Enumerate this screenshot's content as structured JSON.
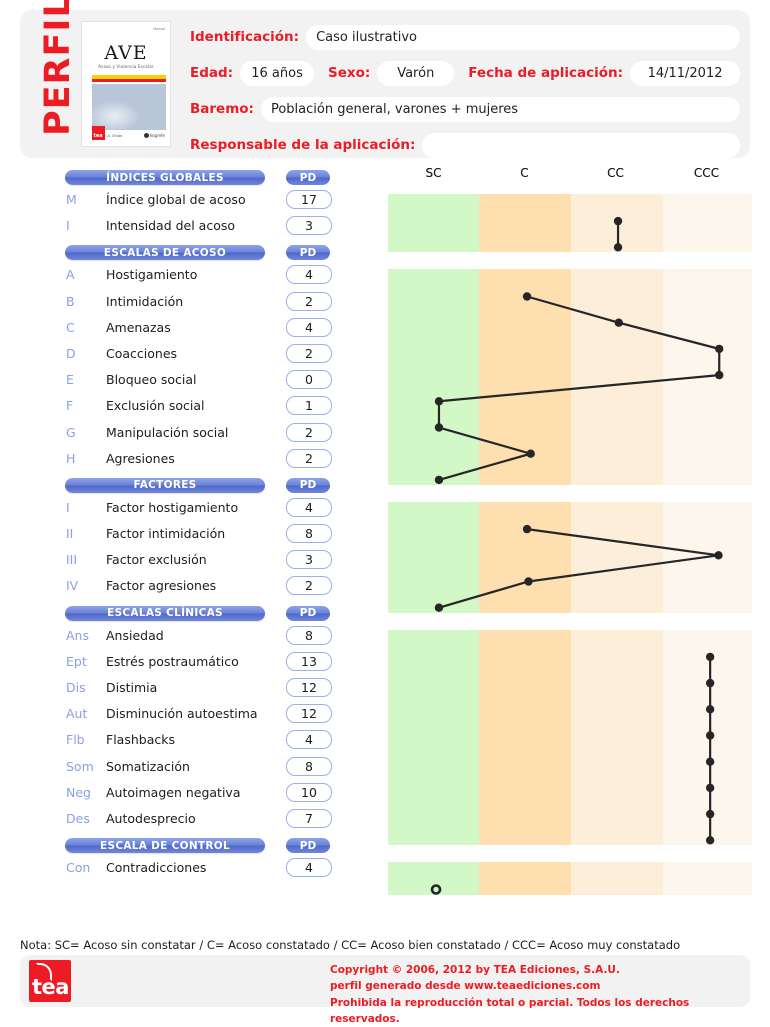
{
  "header": {
    "side_title": "PERFIL",
    "cover": {
      "manual_tag": "Manual",
      "title": "AVE",
      "subtitle": "Acoso y Violencia Escolar",
      "authors": "I. Piñuel\nA. Oñate",
      "brand": "tea",
      "publisher": "hogrefe"
    },
    "fields": [
      {
        "label": "Identificación:",
        "value": "Caso ilustrativo"
      },
      {
        "label": "Edad:",
        "value": "16 años"
      },
      {
        "label": "Sexo:",
        "value": "Varón"
      },
      {
        "label": "Fecha de aplicación:",
        "value": "14/11/2012"
      },
      {
        "label": "Baremo:",
        "value": "Población general, varones + mujeres"
      },
      {
        "label": "Responsable de la aplicación:",
        "value": ""
      }
    ]
  },
  "pd_header": "PD",
  "sections": [
    {
      "title": "ÍNDICES GLOBALES",
      "rows": [
        {
          "code": "M",
          "name": "Índice global de acoso",
          "pd": "17"
        },
        {
          "code": "I",
          "name": "Intensidad del acoso",
          "pd": "3"
        }
      ]
    },
    {
      "title": "ESCALAS DE ACOSO",
      "rows": [
        {
          "code": "A",
          "name": "Hostigamiento",
          "pd": "4"
        },
        {
          "code": "B",
          "name": "Intimidación",
          "pd": "2"
        },
        {
          "code": "C",
          "name": "Amenazas",
          "pd": "4"
        },
        {
          "code": "D",
          "name": "Coacciones",
          "pd": "2"
        },
        {
          "code": "E",
          "name": "Bloqueo social",
          "pd": "0"
        },
        {
          "code": "F",
          "name": "Exclusión social",
          "pd": "1"
        },
        {
          "code": "G",
          "name": "Manipulación social",
          "pd": "2"
        },
        {
          "code": "H",
          "name": "Agresiones",
          "pd": "2"
        }
      ]
    },
    {
      "title": "FACTORES",
      "rows": [
        {
          "code": "I",
          "name": "Factor hostigamiento",
          "pd": "4"
        },
        {
          "code": "II",
          "name": "Factor intimidación",
          "pd": "8"
        },
        {
          "code": "III",
          "name": "Factor exclusión",
          "pd": "3"
        },
        {
          "code": "IV",
          "name": "Factor agresiones",
          "pd": "2"
        }
      ]
    },
    {
      "title": "ESCALAS CLÍNICAS",
      "rows": [
        {
          "code": "Ans",
          "name": "Ansiedad",
          "pd": "8"
        },
        {
          "code": "Ept",
          "name": "Estrés postraumático",
          "pd": "13"
        },
        {
          "code": "Dis",
          "name": "Distimia",
          "pd": "12"
        },
        {
          "code": "Aut",
          "name": "Disminución autoestima",
          "pd": "12"
        },
        {
          "code": "Flb",
          "name": "Flashbacks",
          "pd": "4"
        },
        {
          "code": "Som",
          "name": "Somatización",
          "pd": "8"
        },
        {
          "code": "Neg",
          "name": "Autoimagen negativa",
          "pd": "10"
        },
        {
          "code": "Des",
          "name": "Autodesprecio",
          "pd": "7"
        }
      ]
    },
    {
      "title": "ESCALA DE CONTROL",
      "rows": [
        {
          "code": "Con",
          "name": "Contradicciones",
          "pd": "4"
        }
      ]
    }
  ],
  "chart_data": {
    "type": "line",
    "title": "",
    "xlabel": "",
    "ylabel": "",
    "orientation": "horizontal",
    "grid": false,
    "legend_position": "none",
    "categories": [
      "SC",
      "C",
      "CC",
      "CCC"
    ],
    "band_colors": [
      "#d3f8c8",
      "#fddfb0",
      "#fdeed9",
      "#fdf6ed"
    ],
    "band_labels_top": [
      "SC",
      "C",
      "CC",
      "CCC"
    ],
    "band_labels_bottom": [
      "SC",
      "C",
      "CC",
      "CCC"
    ],
    "marker_color": "#262626",
    "line_color": "#262626",
    "blocks": [
      {
        "name": "ÍNDICES GLOBALES",
        "points": [
          {
            "label": "Índice global de acoso",
            "code": "M",
            "pd": 17,
            "band": "CC",
            "x": 0.632
          },
          {
            "label": "Intensidad del acoso",
            "code": "I",
            "pd": 3,
            "band": "CC",
            "x": 0.632
          }
        ]
      },
      {
        "name": "ESCALAS DE ACOSO",
        "points": [
          {
            "label": "Hostigamiento",
            "code": "A",
            "pd": 4,
            "band": "C",
            "x": 0.382
          },
          {
            "label": "Intimidación",
            "code": "B",
            "pd": 2,
            "band": "CC",
            "x": 0.634
          },
          {
            "label": "Amenazas",
            "code": "C",
            "pd": 4,
            "band": "CCC",
            "x": 0.91
          },
          {
            "label": "Coacciones",
            "code": "D",
            "pd": 2,
            "band": "CCC",
            "x": 0.91
          },
          {
            "label": "Bloqueo social",
            "code": "E",
            "pd": 0,
            "band": "SC",
            "x": 0.14
          },
          {
            "label": "Exclusión social",
            "code": "F",
            "pd": 1,
            "band": "SC",
            "x": 0.14
          },
          {
            "label": "Manipulación social",
            "code": "G",
            "pd": 2,
            "band": "C",
            "x": 0.392
          },
          {
            "label": "Agresiones",
            "code": "H",
            "pd": 2,
            "band": "SC",
            "x": 0.14
          }
        ]
      },
      {
        "name": "FACTORES",
        "points": [
          {
            "label": "Factor hostigamiento",
            "code": "I",
            "pd": 4,
            "band": "C",
            "x": 0.382
          },
          {
            "label": "Factor intimidación",
            "code": "II",
            "pd": 8,
            "band": "CCC",
            "x": 0.908
          },
          {
            "label": "Factor exclusión",
            "code": "III",
            "pd": 3,
            "band": "C",
            "x": 0.386
          },
          {
            "label": "Factor agresiones",
            "code": "IV",
            "pd": 2,
            "band": "SC",
            "x": 0.14
          }
        ]
      },
      {
        "name": "ESCALAS CLÍNICAS",
        "points": [
          {
            "label": "Ansiedad",
            "code": "Ans",
            "pd": 8,
            "band": "CCC",
            "x": 0.885
          },
          {
            "label": "Estrés postraumático",
            "code": "Ept",
            "pd": 13,
            "band": "CCC",
            "x": 0.885
          },
          {
            "label": "Distimia",
            "code": "Dis",
            "pd": 12,
            "band": "CCC",
            "x": 0.885
          },
          {
            "label": "Disminución autoestima",
            "code": "Aut",
            "pd": 12,
            "band": "CCC",
            "x": 0.885
          },
          {
            "label": "Flashbacks",
            "code": "Flb",
            "pd": 4,
            "band": "CCC",
            "x": 0.885
          },
          {
            "label": "Somatización",
            "code": "Som",
            "pd": 8,
            "band": "CCC",
            "x": 0.885
          },
          {
            "label": "Autoimagen negativa",
            "code": "Neg",
            "pd": 10,
            "band": "CCC",
            "x": 0.885
          },
          {
            "label": "Autodesprecio",
            "code": "Des",
            "pd": 7,
            "band": "CCC",
            "x": 0.885
          }
        ]
      },
      {
        "name": "ESCALA DE CONTROL",
        "points": [
          {
            "label": "Contradicciones",
            "code": "Con",
            "pd": 4,
            "band": "SC",
            "x": 0.132,
            "hollow": true
          }
        ]
      }
    ]
  },
  "footer": {
    "note": "Nota: SC= Acoso sin constatar / C= Acoso constatado / CC= Acoso bien constatado / CCC= Acoso muy constatado",
    "logo_text": "tea",
    "copyright_lines": [
      "Copyright © 2006, 2012 by TEA Ediciones, S.A.U.",
      "perfil generado desde www.teaediciones.com",
      "Prohibida la reproducción total o parcial. Todos los derechos reservados."
    ]
  }
}
